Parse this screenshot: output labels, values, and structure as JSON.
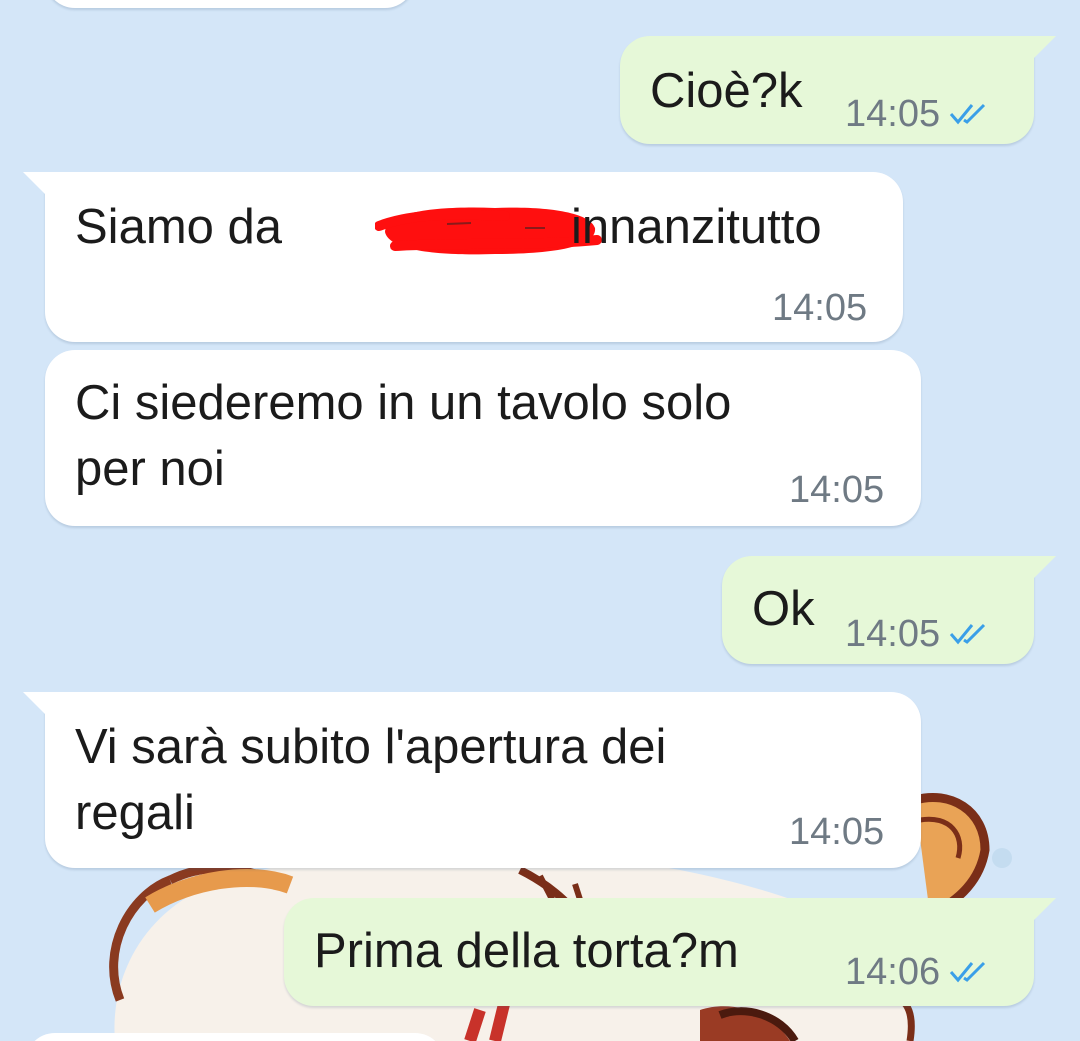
{
  "theme": {
    "chat_background": "#d4e6f8",
    "incoming_bubble": "#ffffff",
    "outgoing_bubble": "#e6f8d8",
    "read_tick_color": "#3a9fe8",
    "redaction_color": "#ff0f0f"
  },
  "messages": [
    {
      "direction": "outgoing",
      "text": "Cioè?k",
      "time": "14:05",
      "status": "read",
      "status_icon": "double-check-icon"
    },
    {
      "direction": "incoming",
      "text_before": "Siamo da",
      "redacted": true,
      "text_after": "innanzitutto",
      "time": "14:05"
    },
    {
      "direction": "incoming",
      "text": "Ci siederemo in un tavolo solo\nper noi",
      "time": "14:05"
    },
    {
      "direction": "outgoing",
      "text": "Ok",
      "time": "14:05",
      "status": "read",
      "status_icon": "double-check-icon"
    },
    {
      "direction": "incoming",
      "text": "Vi sarà subito l'apertura dei\nregali",
      "time": "14:05"
    },
    {
      "direction": "outgoing",
      "text": "Prima della torta?m",
      "time": "14:06",
      "status": "read",
      "status_icon": "double-check-icon"
    }
  ]
}
